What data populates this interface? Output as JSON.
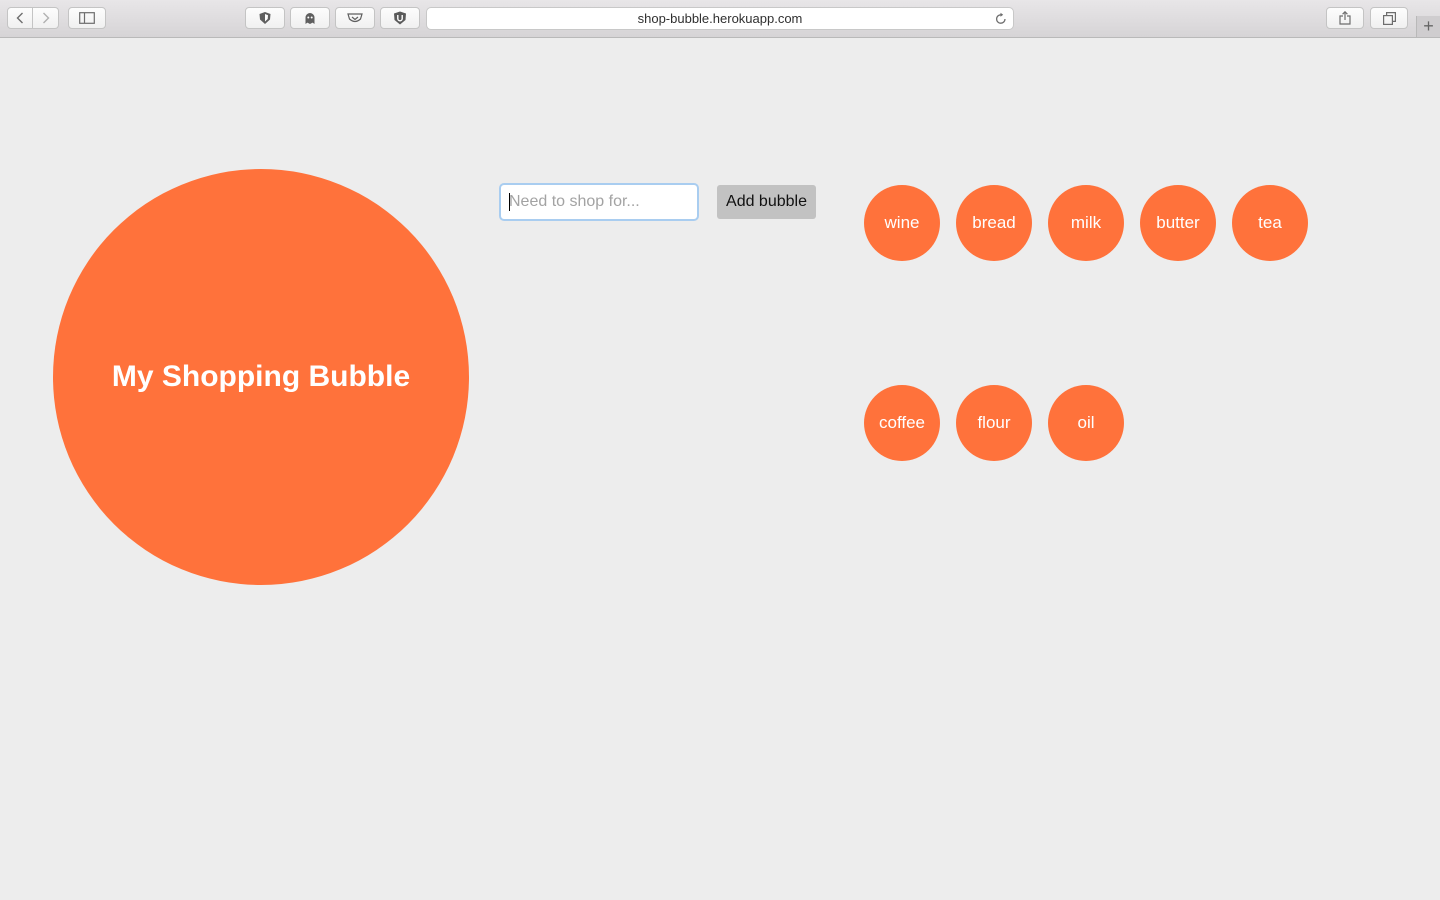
{
  "browser": {
    "url": "shop-bubble.herokuapp.com"
  },
  "page": {
    "title": "My Shopping Bubble",
    "input_placeholder": "Need to shop for...",
    "add_button_label": "Add bubble",
    "accent_color": "#ff723b",
    "items": [
      "wine",
      "bread",
      "milk",
      "butter",
      "tea",
      "coffee",
      "flour",
      "oil"
    ]
  }
}
